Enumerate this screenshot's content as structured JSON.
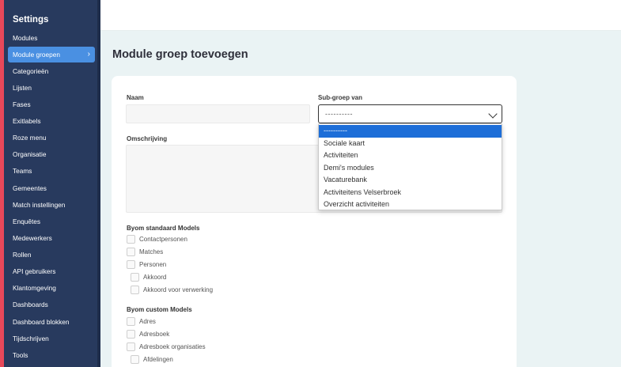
{
  "sidebar": {
    "title": "Settings",
    "items": [
      {
        "label": "Modules"
      },
      {
        "label": "Module groepen",
        "active": true
      },
      {
        "label": "Categorieën"
      },
      {
        "label": "Lijsten"
      },
      {
        "label": "Fases"
      },
      {
        "label": "Exitlabels"
      },
      {
        "label": "Roze menu"
      },
      {
        "label": "Organisatie"
      },
      {
        "label": "Teams"
      },
      {
        "label": "Gemeentes"
      },
      {
        "label": "Match instellingen"
      },
      {
        "label": "Enquêtes"
      },
      {
        "label": "Medewerkers"
      },
      {
        "label": "Rollen"
      },
      {
        "label": "API gebruikers"
      },
      {
        "label": "Klantomgeving"
      },
      {
        "label": "Dashboards"
      },
      {
        "label": "Dashboard blokken"
      },
      {
        "label": "Tijdschrijven"
      },
      {
        "label": "Tools"
      }
    ]
  },
  "main": {
    "title": "Module groep toevoegen",
    "form": {
      "naam_label": "Naam",
      "naam_value": "",
      "subgroep_label": "Sub-groep van",
      "subgroep_value": "----------",
      "omschrijving_label": "Omschrijving",
      "omschrijving_value": "",
      "dropdown_options": [
        "----------",
        "Sociale kaart",
        "Activiteiten",
        "Demi's modules",
        "Vacaturebank",
        "Activiteitens Velserbroek",
        "Overzicht activiteiten"
      ],
      "standaard_label": "Byom standaard Models",
      "standaard_items": [
        {
          "label": "Contactpersonen"
        },
        {
          "label": "Matches"
        },
        {
          "label": "Personen"
        },
        {
          "label": "Akkoord"
        },
        {
          "label": "Akkoord voor verwerking"
        }
      ],
      "custom_label": "Byom custom Models",
      "custom_items": [
        {
          "label": "Adres"
        },
        {
          "label": "Adresboek"
        },
        {
          "label": "Adresboek organisaties"
        },
        {
          "label": "Afdelingen"
        }
      ]
    }
  },
  "colors": {
    "sidebar_bg": "#283a5e",
    "accent": "#4a90e2",
    "sidebar_edge": "#e8485a",
    "selected_option": "#1d6ed8"
  }
}
